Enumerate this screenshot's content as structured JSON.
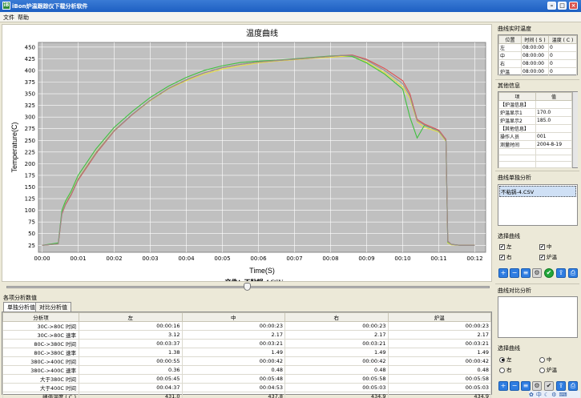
{
  "window": {
    "title": "iBon炉温跟踪仪下载分析软件",
    "icon_text": "iB"
  },
  "menu": {
    "items": [
      "文件",
      "帮助"
    ]
  },
  "chart_data": {
    "type": "line",
    "title": "温度曲线",
    "xlabel": "Time(S)",
    "ylabel": "Temperature(C)",
    "file_label": "文件：不粘锅-4.CSV",
    "ylim": [
      10,
      460
    ],
    "yticks": [
      25,
      50,
      75,
      100,
      125,
      150,
      175,
      200,
      225,
      250,
      275,
      300,
      325,
      350,
      375,
      400,
      425,
      450
    ],
    "xlim": [
      -0.1,
      12.3
    ],
    "xticks": [
      "00:00",
      "00:01",
      "00:02",
      "00:03",
      "00:04",
      "00:05",
      "00:06",
      "00:07",
      "00:08",
      "00:09",
      "00:10",
      "00:11",
      "00:12"
    ],
    "legend_position": "bottom-center",
    "series": [
      {
        "name": "左",
        "color": "#e8e040",
        "x": [
          0,
          0.45,
          0.55,
          0.65,
          0.8,
          1,
          1.5,
          2,
          2.5,
          3,
          3.5,
          4,
          4.5,
          5,
          5.5,
          6,
          6.5,
          7,
          7.5,
          8,
          8.3,
          8.6,
          9,
          9.5,
          10,
          10.2,
          10.4,
          10.6,
          11,
          11.2,
          11.25,
          11.35,
          11.6,
          12
        ],
        "values": [
          25,
          28,
          95,
          115,
          135,
          168,
          225,
          272,
          305,
          335,
          360,
          378,
          392,
          403,
          410,
          416,
          420,
          423,
          426,
          428,
          430,
          430,
          418,
          395,
          365,
          340,
          290,
          278,
          268,
          248,
          30,
          26,
          25,
          25
        ]
      },
      {
        "name": "中",
        "color": "#40c040",
        "x": [
          0,
          0.45,
          0.55,
          0.65,
          0.8,
          1,
          1.5,
          2,
          2.5,
          3,
          3.5,
          4,
          4.5,
          5,
          5.5,
          6,
          6.5,
          7,
          7.5,
          8,
          8.3,
          8.6,
          9,
          9.5,
          10,
          10.2,
          10.4,
          10.6,
          11,
          11.2,
          11.25,
          11.35,
          11.6,
          12
        ],
        "values": [
          25,
          30,
          100,
          120,
          140,
          175,
          232,
          278,
          312,
          342,
          366,
          385,
          400,
          410,
          417,
          420,
          422,
          425,
          428,
          431,
          432,
          430,
          416,
          392,
          360,
          300,
          255,
          282,
          270,
          250,
          32,
          27,
          25,
          25
        ]
      },
      {
        "name": "右",
        "color": "#e05050",
        "x": [
          0,
          0.45,
          0.55,
          0.65,
          0.8,
          1,
          1.5,
          2,
          2.5,
          3,
          3.5,
          4,
          4.5,
          5,
          5.5,
          6,
          6.5,
          7,
          7.5,
          8,
          8.3,
          8.6,
          9,
          9.5,
          10,
          10.2,
          10.4,
          10.6,
          11,
          11.2,
          11.25,
          11.35,
          11.6,
          12
        ],
        "values": [
          25,
          28,
          92,
          112,
          132,
          165,
          222,
          270,
          305,
          336,
          361,
          380,
          395,
          406,
          413,
          418,
          421,
          424,
          427,
          430,
          432,
          433,
          424,
          404,
          378,
          350,
          295,
          285,
          272,
          252,
          34,
          27,
          25,
          25
        ]
      },
      {
        "name": "炉温",
        "color": "#909090",
        "x": [
          0,
          0.45,
          0.55,
          0.65,
          0.8,
          1,
          1.5,
          2,
          2.5,
          3,
          3.5,
          4,
          4.5,
          5,
          5.5,
          6,
          6.5,
          7,
          7.5,
          8,
          8.3,
          8.6,
          9,
          9.5,
          10,
          10.2,
          10.4,
          10.6,
          11,
          11.2,
          11.25,
          11.35,
          11.6,
          12
        ],
        "values": [
          25,
          28,
          94,
          114,
          134,
          167,
          224,
          271,
          306,
          336,
          361,
          380,
          395,
          406,
          413,
          418,
          421,
          424,
          427,
          430,
          432,
          432,
          422,
          400,
          372,
          345,
          292,
          283,
          270,
          250,
          33,
          27,
          25,
          25
        ]
      }
    ]
  },
  "slider": {
    "value": 0.5
  },
  "analysis": {
    "title": "各项分析数值",
    "tabs": [
      "单独分析值",
      "对比分析值"
    ],
    "columns": [
      "分析项",
      "左",
      "中",
      "右",
      "炉温"
    ],
    "rows": [
      [
        "30C->80C 时间",
        "00:00:16",
        "00:00:23",
        "00:00:23",
        "00:00:23"
      ],
      [
        "30C->80C 速率",
        "3.12",
        "2.17",
        "2.17",
        "2.17"
      ],
      [
        "80C->380C 时间",
        "00:03:37",
        "00:03:21",
        "00:03:21",
        "00:03:21"
      ],
      [
        "80C->380C 速率",
        "1.38",
        "1.49",
        "1.49",
        "1.49"
      ],
      [
        "380C->400C 时间",
        "00:00:55",
        "00:00:42",
        "00:00:42",
        "00:00:42"
      ],
      [
        "380C->400C 速率",
        "0.36",
        "0.48",
        "0.48",
        "0.48"
      ],
      [
        "大于380C 时间",
        "00:05:45",
        "00:05:48",
        "00:05:58",
        "00:05:58"
      ],
      [
        "大于400C 时间",
        "00:04:37",
        "00:04:53",
        "00:05:03",
        "00:05:03"
      ],
      [
        "峰值温度 ( C )",
        "431.0",
        "437.8",
        "434.9",
        "434.9"
      ]
    ]
  },
  "realtime": {
    "title": "曲线实时温度",
    "columns": [
      "位置",
      "时间 ( S )",
      "温度 ( C )"
    ],
    "rows": [
      [
        "左",
        "08:00:00",
        "0"
      ],
      [
        "中",
        "08:00:00",
        "0"
      ],
      [
        "右",
        "08:00:00",
        "0"
      ],
      [
        "炉温",
        "08:00:00",
        "0"
      ]
    ]
  },
  "other_info": {
    "title": "其他信息",
    "columns": [
      "项",
      "值"
    ],
    "rows": [
      [
        "【炉温信息】",
        ""
      ],
      [
        "炉温显示1",
        "170.0"
      ],
      [
        "炉温显示2",
        "185.0"
      ],
      [
        "【其他信息】",
        ""
      ],
      [
        "操作人员",
        "001"
      ],
      [
        "测量时间",
        "2004-8-19"
      ],
      [
        "",
        ""
      ],
      [
        "",
        ""
      ],
      [
        "",
        ""
      ]
    ]
  },
  "single_analysis": {
    "title": "曲线单独分析",
    "files": [
      "不粘锅-4.CSV"
    ],
    "select_title": "选择曲线",
    "checkboxes": [
      {
        "label": "左",
        "checked": "✔"
      },
      {
        "label": "中",
        "checked": "✔"
      },
      {
        "label": "右",
        "checked": "✔"
      },
      {
        "label": "炉温",
        "checked": "✔"
      }
    ]
  },
  "compare_analysis": {
    "title": "曲线对比分析",
    "select_title": "选择曲线",
    "radios": [
      {
        "label": "左",
        "selected": true
      },
      {
        "label": "中",
        "selected": false
      },
      {
        "label": "右",
        "selected": false
      },
      {
        "label": "炉温",
        "selected": false
      }
    ]
  },
  "toolbar_icons": [
    "add-icon",
    "remove-icon",
    "list-icon",
    "settings-icon",
    "ok-icon",
    "export-icon",
    "print-icon"
  ],
  "status_icons": [
    "paw-icon",
    "中",
    "moon-icon",
    "settings-icon",
    "ime-icon"
  ]
}
